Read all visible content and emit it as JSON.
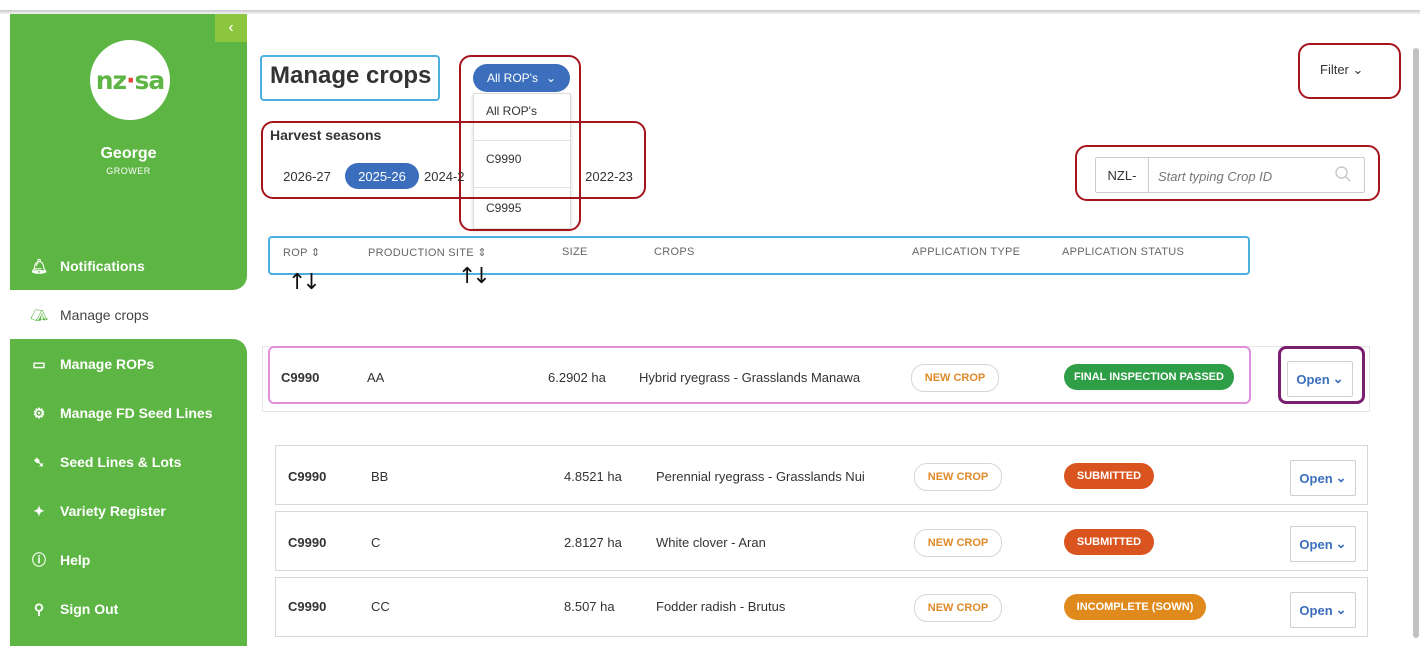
{
  "sidebar": {
    "collapse_glyph": "‹",
    "logo_text_a": "nz",
    "logo_text_dot": "·",
    "logo_text_b": "sa",
    "user_name": "George",
    "user_role": "GROWER",
    "items": [
      {
        "label": "Notifications",
        "icon": "bell-icon",
        "glyph": "🔔︎"
      },
      {
        "label": "Manage crops",
        "icon": "crop-icon",
        "glyph": "⛺︎"
      },
      {
        "label": "Manage ROPs",
        "icon": "map-icon",
        "glyph": "▭"
      },
      {
        "label": "Manage FD Seed Lines",
        "icon": "gear-icon",
        "glyph": "⚙"
      },
      {
        "label": "Seed Lines & Lots",
        "icon": "seed-icon",
        "glyph": "➷"
      },
      {
        "label": "Variety Register",
        "icon": "sprout-icon",
        "glyph": "✦"
      },
      {
        "label": "Help",
        "icon": "info-icon",
        "glyph": "ⓘ"
      },
      {
        "label": "Sign Out",
        "icon": "user-icon",
        "glyph": "⚲"
      }
    ]
  },
  "main": {
    "title": "Manage crops",
    "rop_dropdown": {
      "selected": "All ROP's",
      "options": [
        "All ROP's",
        "C9990",
        "C9995"
      ]
    },
    "harvest_label": "Harvest seasons",
    "seasons": [
      "2026-27",
      "2025-26",
      "2024-2",
      "2022-23"
    ],
    "active_season": "2025-26",
    "filter_label": "Filter",
    "search": {
      "prefix": "NZL-",
      "placeholder": "Start typing Crop ID"
    },
    "columns": [
      "ROP",
      "PRODUCTION SITE",
      "SIZE",
      "CROPS",
      "APPLICATION TYPE",
      "APPLICATION STATUS"
    ],
    "sort_glyph": "⇕",
    "rows": [
      {
        "rop": "C9990",
        "site": "AA",
        "size": "6.2902 ha",
        "crop": "Hybrid ryegrass - Grasslands Manawa",
        "type": "NEW CROP",
        "status": "FINAL INSPECTION PASSED",
        "status_color": "#2e9e47",
        "action": "Open"
      },
      {
        "rop": "C9990",
        "site": "BB",
        "size": "4.8521 ha",
        "crop": "Perennial ryegrass - Grasslands Nui",
        "type": "NEW CROP",
        "status": "SUBMITTED",
        "status_color": "#d9541e",
        "action": "Open"
      },
      {
        "rop": "C9990",
        "site": "C",
        "size": "2.8127 ha",
        "crop": "White clover - Aran",
        "type": "NEW CROP",
        "status": "SUBMITTED",
        "status_color": "#d9541e",
        "action": "Open"
      },
      {
        "rop": "C9990",
        "site": "CC",
        "size": "8.507 ha",
        "crop": "Fodder radish - Brutus",
        "type": "NEW CROP",
        "status": "INCOMPLETE (SOWN)",
        "status_color": "#e08a1e",
        "action": "Open"
      }
    ]
  }
}
